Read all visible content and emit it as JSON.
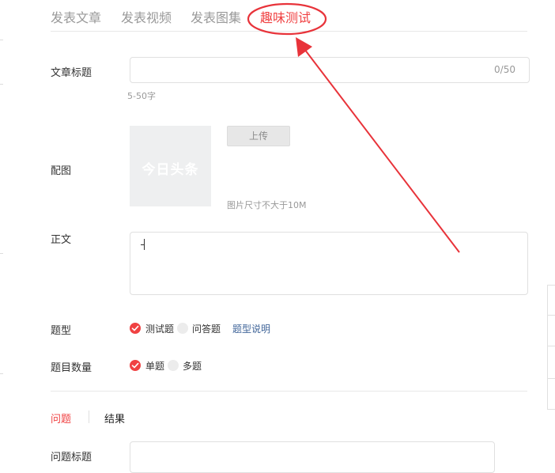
{
  "tabs": [
    {
      "label": "发表文章"
    },
    {
      "label": "发表视频"
    },
    {
      "label": "发表图集"
    },
    {
      "label": "趣味测试"
    }
  ],
  "article_title": {
    "label": "文章标题",
    "value": "",
    "counter": "0/50",
    "hint": "5-50字"
  },
  "cover": {
    "label": "配图",
    "thumbnail_logo": "今日头条",
    "upload_label": "上传",
    "size_hint": "图片尺寸不大于10M"
  },
  "body_text": {
    "label": "正文",
    "value": ""
  },
  "question_type": {
    "label": "题型",
    "options": [
      {
        "label": "测试题",
        "checked": true
      },
      {
        "label": "问答题",
        "checked": false
      }
    ],
    "help_link": "题型说明"
  },
  "question_count": {
    "label": "题目数量",
    "options": [
      {
        "label": "单题",
        "checked": true
      },
      {
        "label": "多题",
        "checked": false
      }
    ]
  },
  "sub_tabs": [
    {
      "label": "问题",
      "active": true
    },
    {
      "label": "结果",
      "active": false
    }
  ],
  "question_title": {
    "label": "问题标题",
    "value": ""
  },
  "annotation": {
    "color": "#e8333a"
  }
}
